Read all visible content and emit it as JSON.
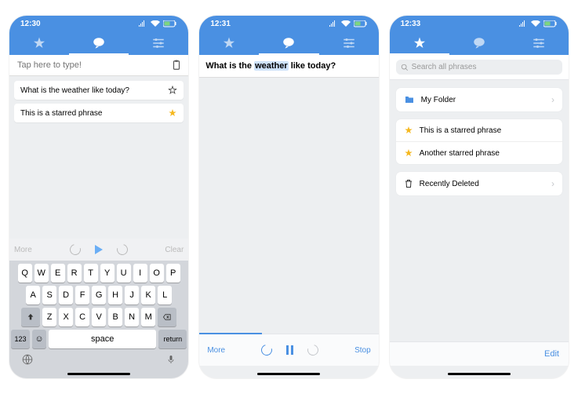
{
  "screen1": {
    "time": "12:30",
    "placeholder": "Tap here to type!",
    "phrases": [
      {
        "text": "What is the weather like today?",
        "starred": false
      },
      {
        "text": "This is a starred phrase",
        "starred": true
      }
    ],
    "toolbar": {
      "more": "More",
      "clear": "Clear"
    },
    "kb_rows": [
      [
        "Q",
        "W",
        "E",
        "R",
        "T",
        "Y",
        "U",
        "I",
        "O",
        "P"
      ],
      [
        "A",
        "S",
        "D",
        "F",
        "G",
        "H",
        "J",
        "K",
        "L"
      ],
      [
        "Z",
        "X",
        "C",
        "V",
        "B",
        "N",
        "M"
      ]
    ],
    "num_key": "123",
    "space": "space",
    "return": "return"
  },
  "screen2": {
    "time": "12:31",
    "sentence_pre": "What is the ",
    "word": "weather",
    "sentence_post": " like today?",
    "more": "More",
    "stop": "Stop"
  },
  "screen3": {
    "time": "12:33",
    "search": "Search all phrases",
    "folder": "My Folder",
    "starred": [
      "This is a starred phrase",
      "Another starred phrase"
    ],
    "deleted": "Recently Deleted",
    "edit": "Edit"
  }
}
